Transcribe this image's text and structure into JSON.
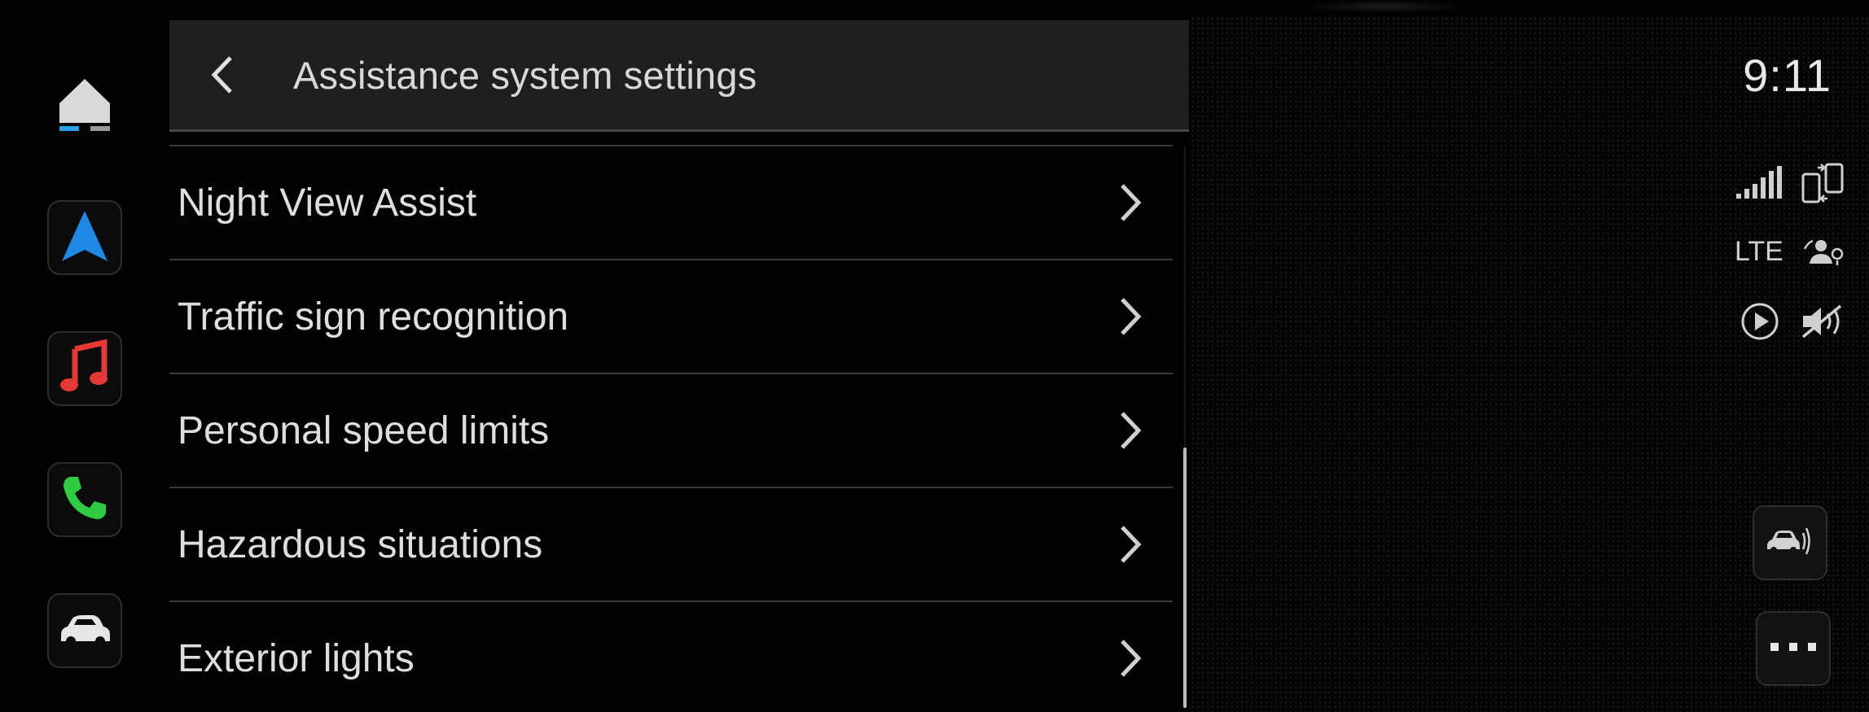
{
  "header": {
    "title": "Assistance system settings"
  },
  "status": {
    "time": "9:11",
    "network": "LTE"
  },
  "settings_items": [
    {
      "label": "Night View Assist"
    },
    {
      "label": "Traffic sign recognition"
    },
    {
      "label": "Personal speed limits"
    },
    {
      "label": "Hazardous situations"
    },
    {
      "label": "Exterior lights"
    }
  ],
  "dock": {
    "items": [
      {
        "icon": "home-icon"
      },
      {
        "icon": "navigation-icon",
        "accent": "#1e88e5"
      },
      {
        "icon": "music-icon",
        "accent": "#e53935"
      },
      {
        "icon": "phone-icon",
        "accent": "#2ecc40"
      },
      {
        "icon": "car-icon"
      }
    ],
    "home_indicator_colors": [
      "#29a3e6",
      "#9a9a9a"
    ]
  },
  "colors": {
    "background": "#000000",
    "header_background": "#1f1f1f",
    "divider": "#3a3a3a",
    "text": "#dedede"
  }
}
